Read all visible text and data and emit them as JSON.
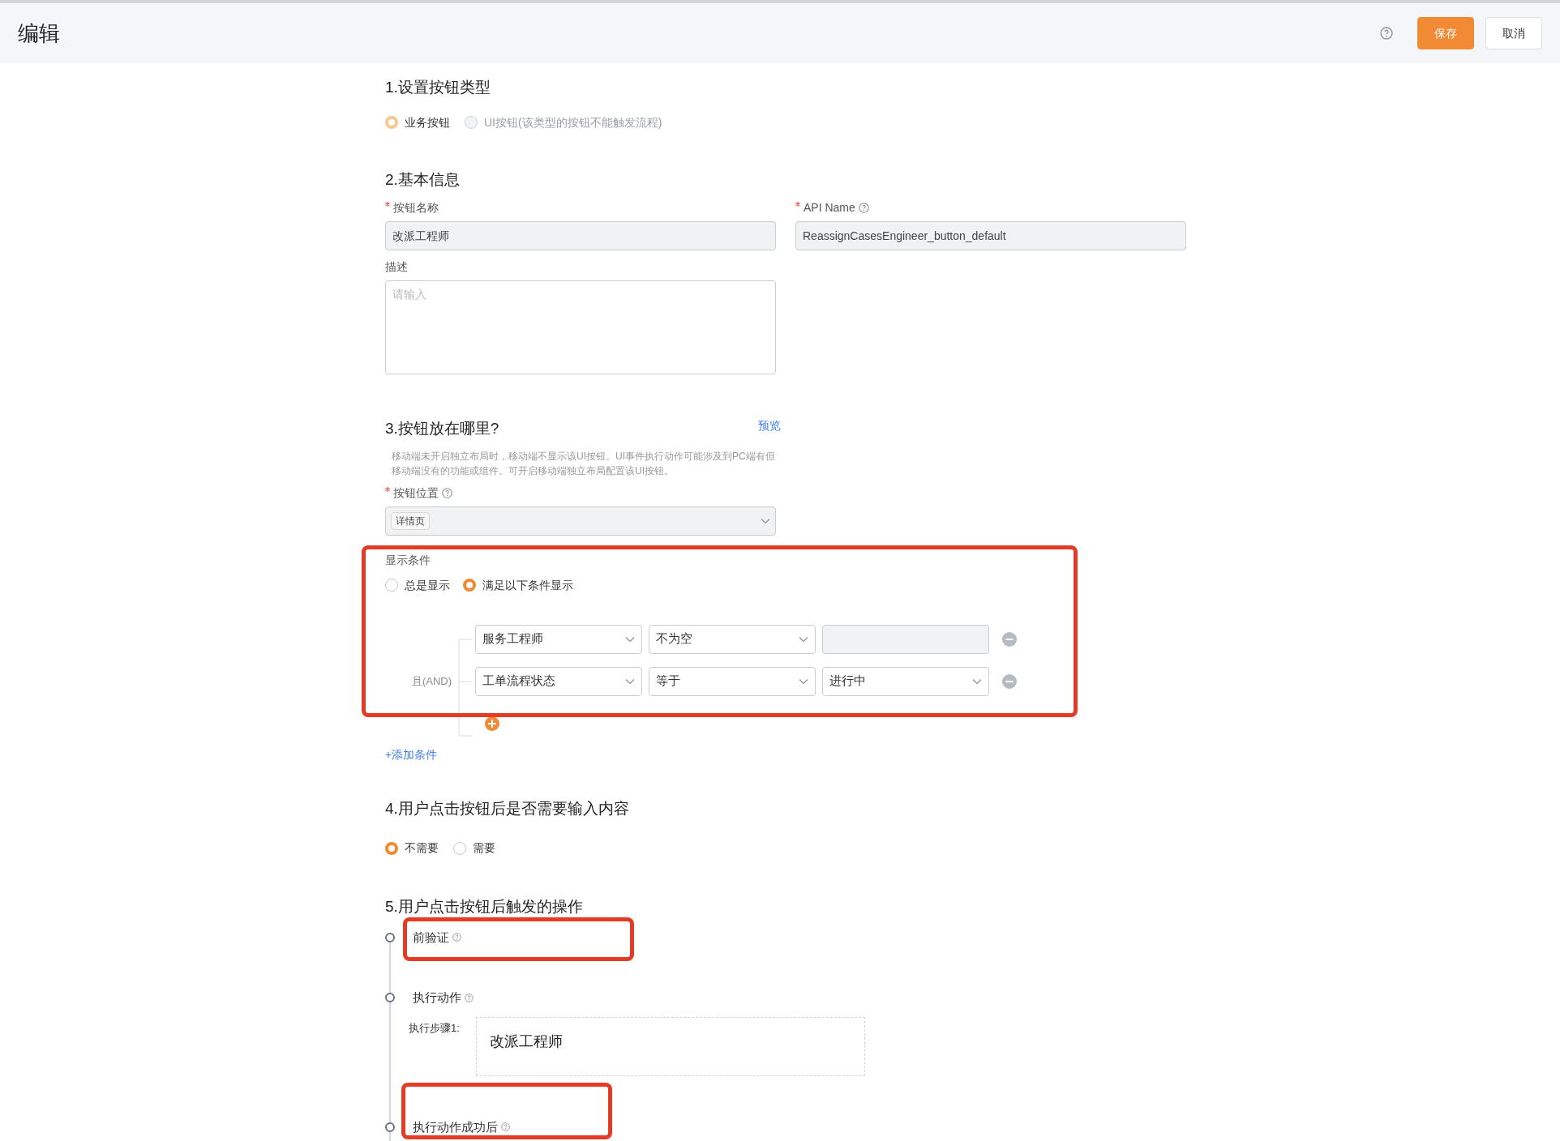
{
  "header": {
    "title": "编辑",
    "buttons": [
      {
        "label": "保存",
        "kind": "primary"
      },
      {
        "label": "取消",
        "kind": "default"
      }
    ]
  },
  "section_1": {
    "title": "1.设置按钮类型",
    "options": [
      {
        "label": "业务按钮",
        "selected": true,
        "disabled": true
      },
      {
        "label": "UI按钮(该类型的按钮不能触发流程)",
        "selected": false,
        "disabled": true
      }
    ]
  },
  "section_2": {
    "title": "2.基本信息",
    "name_field": {
      "label": "按钮名称",
      "required": true,
      "value": "改派工程师"
    },
    "api_name_field": {
      "label": "API Name",
      "required": true,
      "value": "ReassignCasesEngineer_button_default"
    },
    "description_field": {
      "label": "描述",
      "placeholder": "请输入"
    }
  },
  "section_3": {
    "title": "3.按钮放在哪里?",
    "preview_link": "预览",
    "hint": "移动端未开启独立布局时，移动端不显示该UI按钮。UI事件执行动作可能涉及到PC端有但移动端没有的功能或组件。可开启移动端独立布局配置该UI按钮。",
    "position_field": {
      "label": "按钮位置",
      "required": true,
      "tag": "详情页"
    },
    "display_condition": {
      "label": "显示条件",
      "options": [
        {
          "label": "总是显示",
          "selected": false
        },
        {
          "label": "满足以下条件显示",
          "selected": true
        }
      ],
      "connector": "且(AND)",
      "rows": [
        {
          "field": "服务工程师",
          "operator": "不为空"
        },
        {
          "field": "工单流程状态",
          "operator": "等于",
          "value": "进行中"
        }
      ]
    },
    "add_link": "+添加条件"
  },
  "section_4": {
    "title": "4.用户点击按钮后是否需要输入内容",
    "options": [
      {
        "label": "不需要",
        "selected": true
      },
      {
        "label": "需要",
        "selected": false
      }
    ]
  },
  "section_5": {
    "title": "5.用户点击按钮后触发的操作",
    "steps": [
      {
        "label": "前验证"
      },
      {
        "label": "执行动作",
        "step_label": "执行步骤1:",
        "step_value": "改派工程师"
      },
      {
        "label": "执行动作成功后"
      }
    ]
  }
}
